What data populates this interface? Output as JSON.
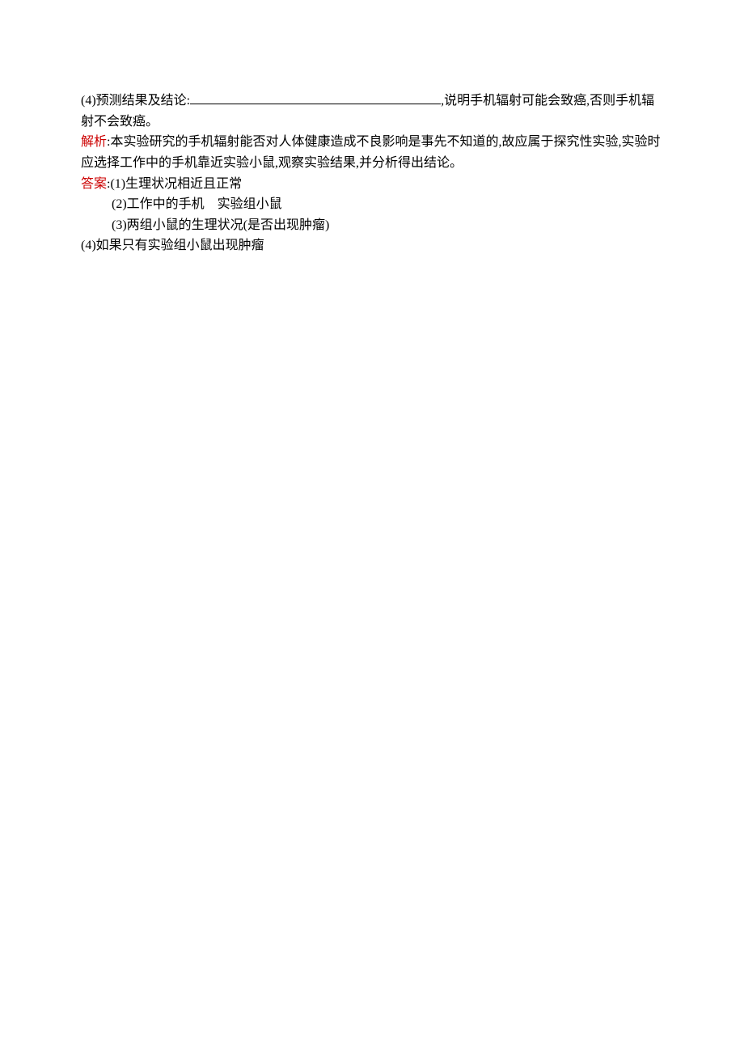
{
  "q4": {
    "prefix": "(4)预测结果及结论:",
    "suffix": ",说明手机辐射可能会致癌,否则手机辐射不会致癌。"
  },
  "analysis": {
    "label": "解析",
    "text": ":本实验研究的手机辐射能否对人体健康造成不良影响是事先不知道的,故应属于探究性实验,实验时应选择工作中的手机靠近实验小鼠,观察实验结果,并分析得出结论。"
  },
  "answer": {
    "label": "答案",
    "items": [
      ":(1)生理状况相近且正常",
      "(2)工作中的手机　实验组小鼠",
      "(3)两组小鼠的生理状况(是否出现肿瘤)"
    ],
    "item4": "(4)如果只有实验组小鼠出现肿瘤"
  }
}
